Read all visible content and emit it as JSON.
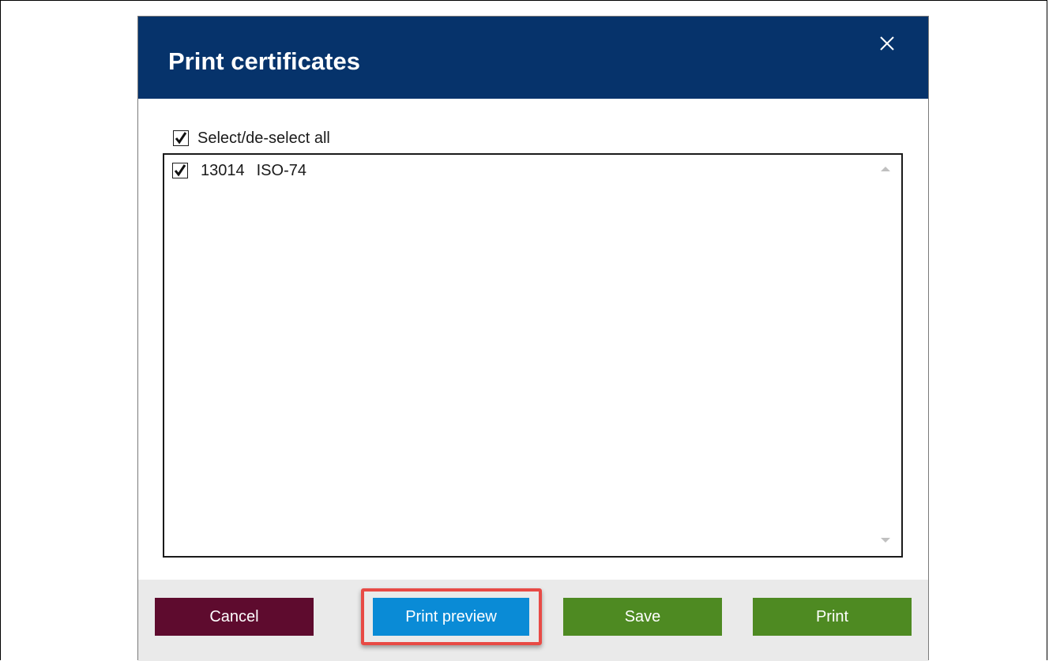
{
  "dialog": {
    "title": "Print certificates",
    "close_icon": "close-icon"
  },
  "select_all": {
    "label": "Select/de-select all",
    "checked": true
  },
  "certificates": [
    {
      "id": "13014",
      "name": "ISO-74",
      "checked": true
    }
  ],
  "buttons": {
    "cancel": "Cancel",
    "print_preview": "Print preview",
    "save": "Save",
    "print": "Print"
  },
  "colors": {
    "title_bar": "#06336b",
    "cancel": "#5e0b2e",
    "print_preview": "#0a8bd6",
    "save": "#4e8a22",
    "print": "#4e8a22",
    "highlight": "#e84a45",
    "footer": "#eaeaea"
  },
  "highlighted_button": "print_preview"
}
